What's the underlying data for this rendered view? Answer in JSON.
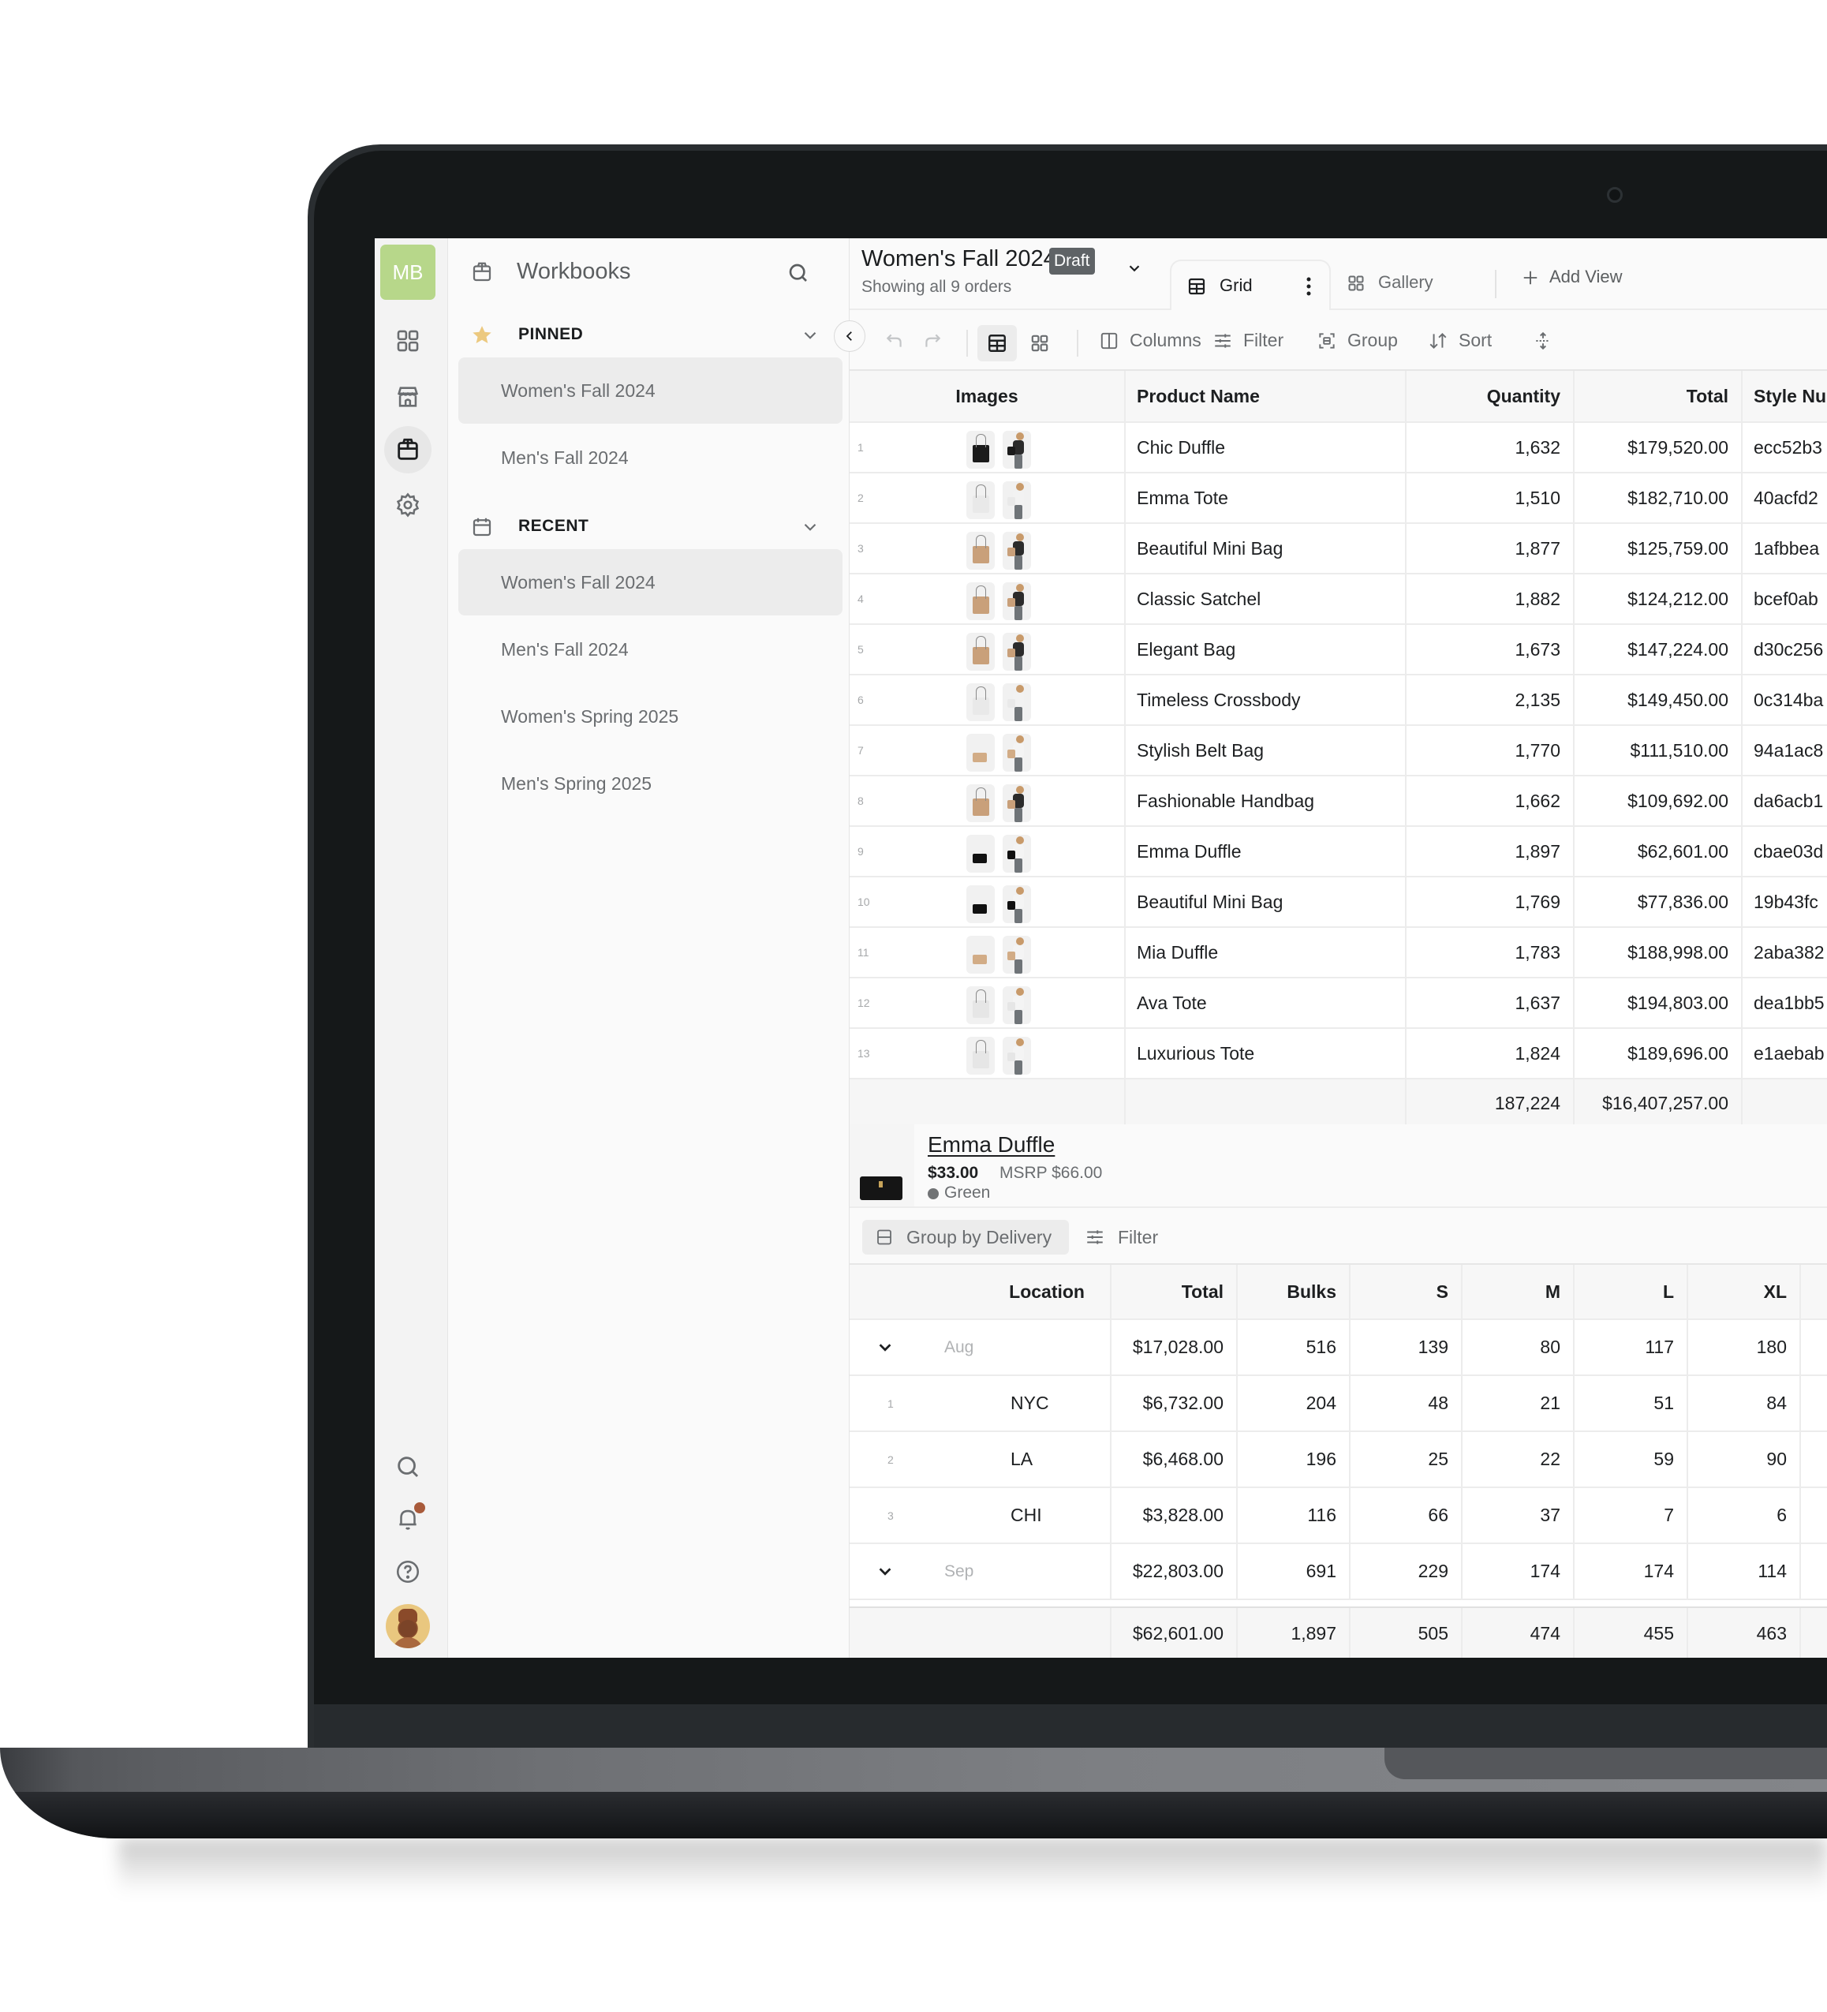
{
  "rail": {
    "badge": "MB",
    "icons": [
      "dashboard-icon",
      "storefront-icon",
      "workbook-icon",
      "settings-icon"
    ],
    "bottom_icons": [
      "search-icon",
      "bell-icon",
      "help-icon"
    ],
    "notification_color": "#a85a3a",
    "badge_color": "#b7d78a"
  },
  "sidebar": {
    "title": "Workbooks",
    "pinned": {
      "label": "PINNED",
      "items": [
        {
          "label": "Women's Fall 2024",
          "selected": true
        },
        {
          "label": "Men's Fall 2024",
          "selected": false
        }
      ]
    },
    "recent": {
      "label": "RECENT",
      "items": [
        {
          "label": "Women's Fall 2024",
          "selected": true
        },
        {
          "label": "Men's Fall 2024",
          "selected": false
        },
        {
          "label": "Women's Spring 2025",
          "selected": false
        },
        {
          "label": "Men's Spring 2025",
          "selected": false
        }
      ]
    }
  },
  "header": {
    "title": "Women's Fall 2024",
    "badge": "Draft",
    "subtitle": "Showing all 9 orders",
    "tabs": [
      {
        "label": "Grid",
        "active": true
      },
      {
        "label": "Gallery",
        "active": false
      }
    ],
    "add_view": "Add View"
  },
  "toolbar": {
    "columns": "Columns",
    "filter": "Filter",
    "group": "Group",
    "sort": "Sort"
  },
  "orders": {
    "columns": [
      "Images",
      "Product Name",
      "Quantity",
      "Total",
      "Style Nu"
    ],
    "rows": [
      {
        "n": "1",
        "name": "Chic Duffle",
        "qty": "1,632",
        "total": "$179,520.00",
        "style": "ecc52b3",
        "bag": "#1b1b1b",
        "top": "#2b2b2b"
      },
      {
        "n": "2",
        "name": "Emma Tote",
        "qty": "1,510",
        "total": "$182,710.00",
        "style": "40acfd2",
        "bag": "#e9e9e9",
        "top": "#f2f2f2"
      },
      {
        "n": "3",
        "name": "Beautiful Mini Bag",
        "qty": "1,877",
        "total": "$125,759.00",
        "style": "1afbbea",
        "bag": "#c9a07a",
        "top": "#2b2b2b"
      },
      {
        "n": "4",
        "name": "Classic Satchel",
        "qty": "1,882",
        "total": "$124,212.00",
        "style": "bcef0ab",
        "bag": "#c9a07a",
        "top": "#2b2b2b"
      },
      {
        "n": "5",
        "name": "Elegant Bag",
        "qty": "1,673",
        "total": "$147,224.00",
        "style": "d30c256",
        "bag": "#c9a07a",
        "top": "#2b2b2b"
      },
      {
        "n": "6",
        "name": "Timeless Crossbody",
        "qty": "2,135",
        "total": "$149,450.00",
        "style": "0c314ba",
        "bag": "#e9e9e9",
        "top": "#f2f2f2"
      },
      {
        "n": "7",
        "name": "Stylish Belt Bag",
        "qty": "1,770",
        "total": "$111,510.00",
        "style": "94a1ac8",
        "bag": "#d2ac86",
        "top": "#f4f4f4",
        "small": true
      },
      {
        "n": "8",
        "name": "Fashionable Handbag",
        "qty": "1,662",
        "total": "$109,692.00",
        "style": "da6acb1",
        "bag": "#c9a07a",
        "top": "#2b2b2b"
      },
      {
        "n": "9",
        "name": "Emma Duffle",
        "qty": "1,897",
        "total": "$62,601.00",
        "style": "cbae03d",
        "bag": "#111111",
        "top": "#f4f4f4",
        "small": true
      },
      {
        "n": "10",
        "name": "Beautiful Mini Bag",
        "qty": "1,769",
        "total": "$77,836.00",
        "style": "19b43fc",
        "bag": "#111111",
        "top": "#f4f4f4",
        "small": true
      },
      {
        "n": "11",
        "name": "Mia Duffle",
        "qty": "1,783",
        "total": "$188,998.00",
        "style": "2aba382",
        "bag": "#d2ac86",
        "top": "#f4f4f4",
        "small": true
      },
      {
        "n": "12",
        "name": "Ava Tote",
        "qty": "1,637",
        "total": "$194,803.00",
        "style": "dea1bb5",
        "bag": "#e6e6e6",
        "top": "#f4f4f4"
      },
      {
        "n": "13",
        "name": "Luxurious Tote",
        "qty": "1,824",
        "total": "$189,696.00",
        "style": "e1aebab",
        "bag": "#e6e6e6",
        "top": "#f4f4f4"
      }
    ],
    "footer": {
      "qty": "187,224",
      "total": "$16,407,257.00"
    }
  },
  "detail": {
    "name": "Emma Duffle",
    "price": "$33.00",
    "msrp": "MSRP $66.00",
    "color": "Green"
  },
  "group_bar": {
    "group_label": "Group by Delivery",
    "filter_label": "Filter"
  },
  "delivery": {
    "columns": [
      "Location",
      "Total",
      "Bulks",
      "S",
      "M",
      "L",
      "XL"
    ],
    "rows": [
      {
        "type": "group",
        "label": "Aug",
        "total": "$17,028.00",
        "bulks": "516",
        "s": "139",
        "m": "80",
        "l": "117",
        "xl": "180"
      },
      {
        "type": "row",
        "n": "1",
        "label": "NYC",
        "total": "$6,732.00",
        "bulks": "204",
        "s": "48",
        "m": "21",
        "l": "51",
        "xl": "84"
      },
      {
        "type": "row",
        "n": "2",
        "label": "LA",
        "total": "$6,468.00",
        "bulks": "196",
        "s": "25",
        "m": "22",
        "l": "59",
        "xl": "90"
      },
      {
        "type": "row",
        "n": "3",
        "label": "CHI",
        "total": "$3,828.00",
        "bulks": "116",
        "s": "66",
        "m": "37",
        "l": "7",
        "xl": "6"
      },
      {
        "type": "group",
        "label": "Sep",
        "total": "$22,803.00",
        "bulks": "691",
        "s": "229",
        "m": "174",
        "l": "174",
        "xl": "114"
      }
    ],
    "footer": {
      "total": "$62,601.00",
      "bulks": "1,897",
      "s": "505",
      "m": "474",
      "l": "455",
      "xl": "463"
    }
  }
}
